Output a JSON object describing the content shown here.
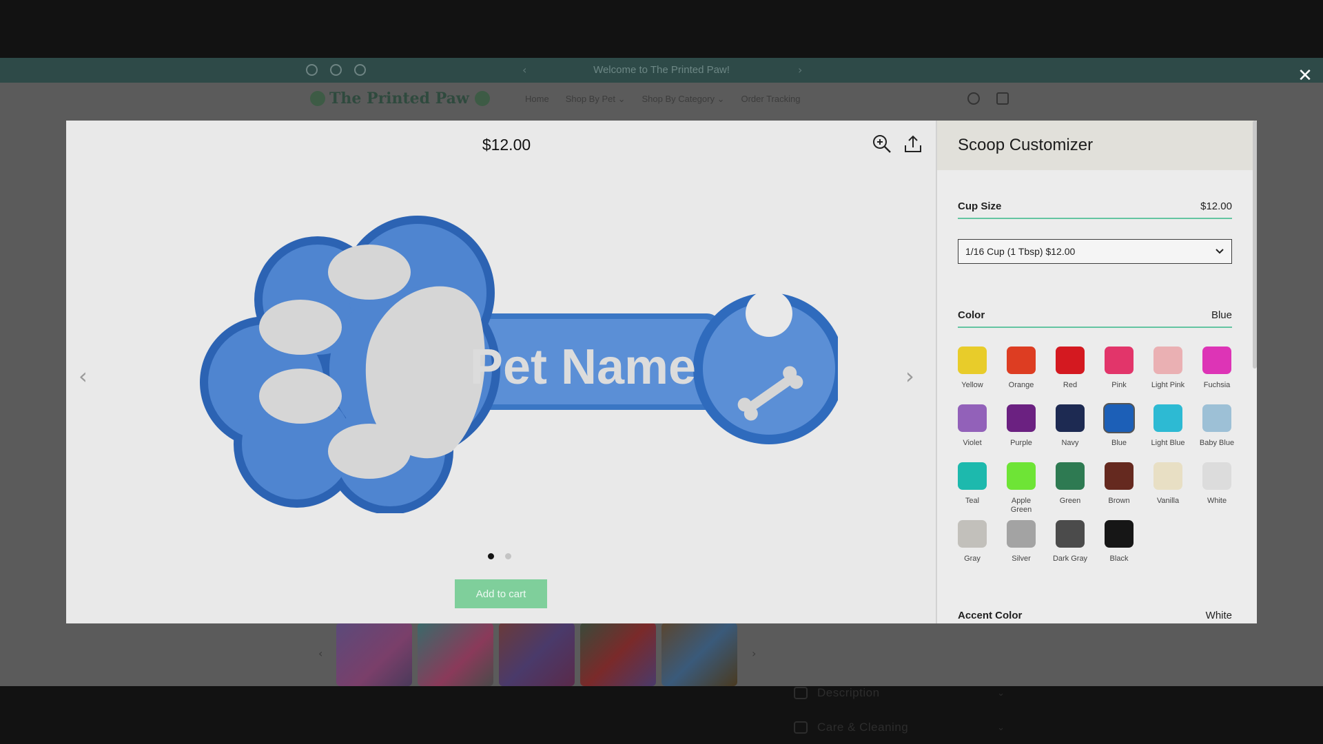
{
  "announcement": {
    "text": "Welcome to The Printed Paw!",
    "prev_arrow": "‹",
    "next_arrow": "›"
  },
  "site": {
    "logo": "The Printed Paw",
    "nav": [
      "Home",
      "Shop By Pet ⌄",
      "Shop By Category ⌄",
      "Order Tracking"
    ],
    "accordions": [
      {
        "label": "Description",
        "icon": "paw-icon"
      },
      {
        "label": "Care & Cleaning",
        "icon": "basin-icon"
      }
    ],
    "thumbnail_prev": "‹",
    "thumbnail_next": "›"
  },
  "modal": {
    "close_glyph": "✕",
    "price": "$12.00",
    "gallery_prev": "‹",
    "gallery_next": "›",
    "product_text": "Pet Name",
    "add_to_cart": "Add to cart",
    "slide_count": 2,
    "active_slide": 1
  },
  "customizer": {
    "title": "Scoop Customizer",
    "cup_size": {
      "label": "Cup Size",
      "price": "$12.00",
      "selected": "1/16 Cup (1 Tbsp) $12.00"
    },
    "color": {
      "label": "Color",
      "selected": "Blue",
      "options": [
        {
          "name": "Yellow",
          "hex": "#e8cc2a"
        },
        {
          "name": "Orange",
          "hex": "#dd3d22"
        },
        {
          "name": "Red",
          "hex": "#d41920"
        },
        {
          "name": "Pink",
          "hex": "#e2356a"
        },
        {
          "name": "Light Pink",
          "hex": "#eab0b3"
        },
        {
          "name": "Fuchsia",
          "hex": "#dd34b6"
        },
        {
          "name": "Violet",
          "hex": "#9261b9"
        },
        {
          "name": "Purple",
          "hex": "#6b2181"
        },
        {
          "name": "Navy",
          "hex": "#1d2a52"
        },
        {
          "name": "Blue",
          "hex": "#1c5fb7"
        },
        {
          "name": "Light Blue",
          "hex": "#2dbad3"
        },
        {
          "name": "Baby Blue",
          "hex": "#9dc0d6"
        },
        {
          "name": "Teal",
          "hex": "#1db9ad"
        },
        {
          "name": "Apple Green",
          "hex": "#6ee436"
        },
        {
          "name": "Green",
          "hex": "#2e7a52"
        },
        {
          "name": "Brown",
          "hex": "#65291f"
        },
        {
          "name": "Vanilla",
          "hex": "#e8dfc4"
        },
        {
          "name": "White",
          "hex": "#dcdcdc"
        },
        {
          "name": "Gray",
          "hex": "#c2c0bb"
        },
        {
          "name": "Silver",
          "hex": "#a3a3a3"
        },
        {
          "name": "Dark Gray",
          "hex": "#4b4b4b"
        },
        {
          "name": "Black",
          "hex": "#161616"
        }
      ]
    },
    "accent_color": {
      "label": "Accent Color",
      "selected": "White"
    }
  }
}
